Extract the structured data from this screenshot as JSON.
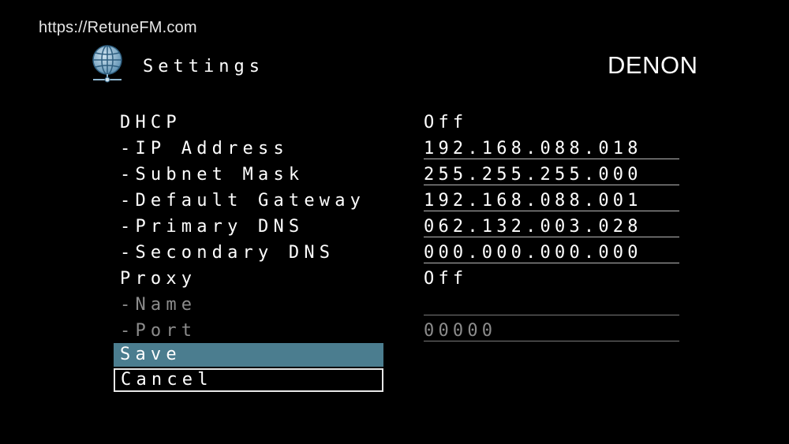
{
  "watermark": "https://RetuneFM.com",
  "header": {
    "icon": "globe-network-icon",
    "title": "Settings",
    "brand": "DENON"
  },
  "rows": [
    {
      "label": "DHCP",
      "value": "Off",
      "underlined": false,
      "disabled": false
    },
    {
      "label": "-IP Address",
      "value": "192.168.088.018",
      "underlined": true,
      "disabled": false
    },
    {
      "label": "-Subnet Mask",
      "value": "255.255.255.000",
      "underlined": true,
      "disabled": false
    },
    {
      "label": "-Default Gateway",
      "value": "192.168.088.001",
      "underlined": true,
      "disabled": false
    },
    {
      "label": "-Primary DNS",
      "value": "062.132.003.028",
      "underlined": true,
      "disabled": false
    },
    {
      "label": "-Secondary DNS",
      "value": "000.000.000.000",
      "underlined": true,
      "disabled": false
    },
    {
      "label": "Proxy",
      "value": "Off",
      "underlined": false,
      "disabled": false
    },
    {
      "label": "-Name",
      "value": "",
      "underlined": true,
      "disabled": true
    },
    {
      "label": "-Port",
      "value": "00000",
      "underlined": true,
      "disabled": true
    }
  ],
  "buttons": {
    "save": "Save",
    "cancel": "Cancel"
  },
  "colors": {
    "background": "#000000",
    "selected": "#4b7d8f",
    "disabled_text": "#8c8c8c",
    "icon": "#8fb6cf"
  }
}
